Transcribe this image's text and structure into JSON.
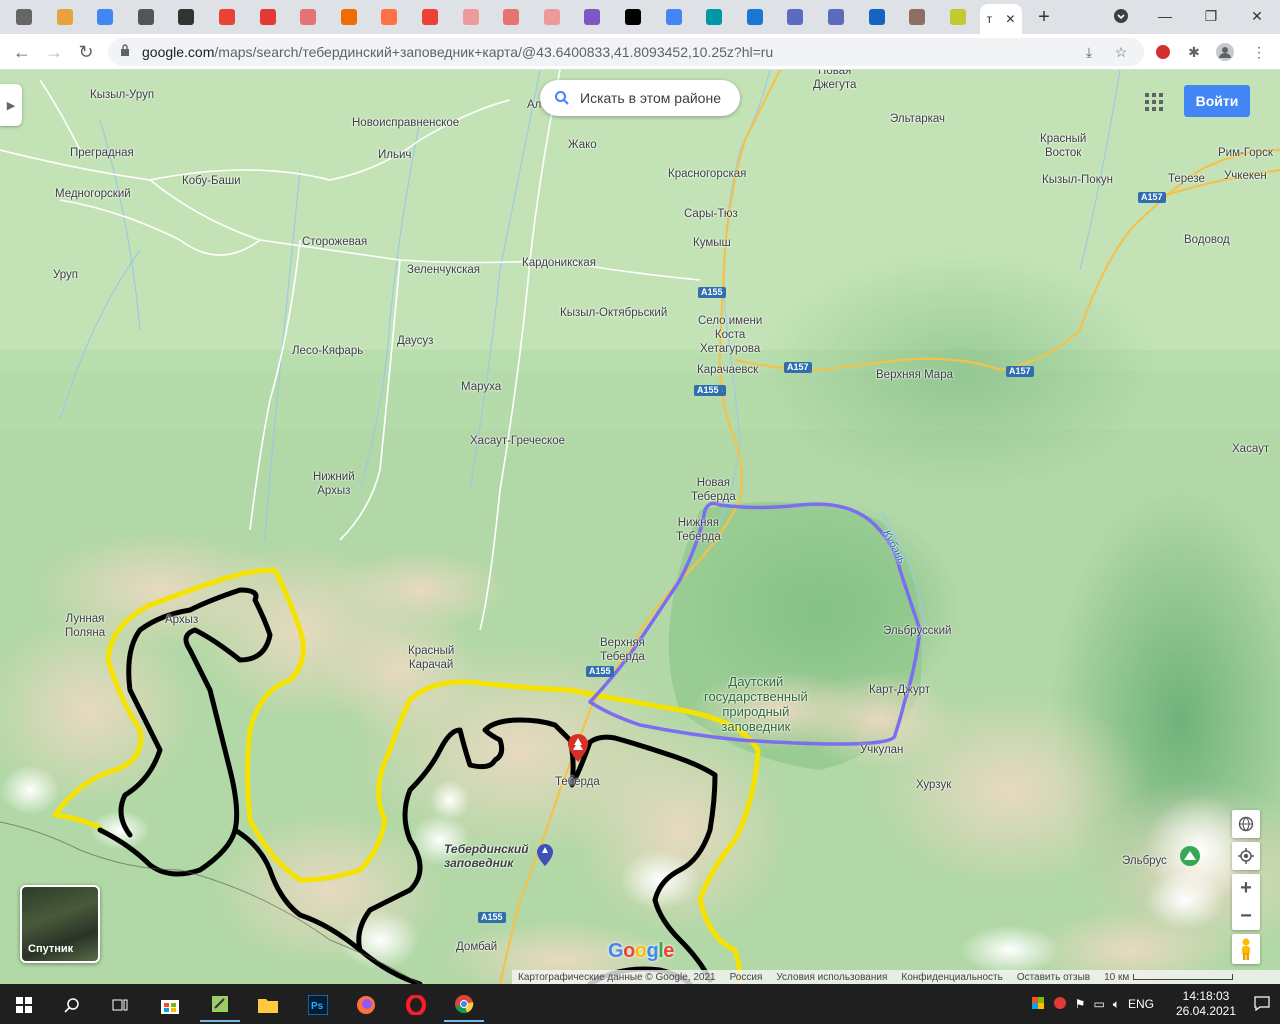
{
  "browser": {
    "active_tab_title": "т",
    "url_host": "google.com",
    "url_rest": "/maps/search/тебердинский+заповедник+карта/@43.6400833,41.8093452,10.25z?hl=ru",
    "tab_count": 24
  },
  "map": {
    "search_area_label": "Искать в этом районе",
    "signin_label": "Войти",
    "satellite_label": "Спутник",
    "google_logo": "Google",
    "attribution": {
      "data": "Картографические данные © Google, 2021",
      "country": "Россия",
      "terms": "Условия использования",
      "privacy": "Конфиденциальность",
      "feedback": "Оставить отзыв",
      "scale": "10 км"
    },
    "places": [
      {
        "id": "kyzyl-urup",
        "text": "Кызыл-Уруп"
      },
      {
        "id": "novoispravnenskoe",
        "text": "Новоисправненское"
      },
      {
        "id": "al",
        "text": "Ал"
      },
      {
        "id": "novaya-dzheguta",
        "text": "Новая\nДжегута"
      },
      {
        "id": "eltarkach",
        "text": "Эльтаркач"
      },
      {
        "id": "pregradnaya",
        "text": "Преградная"
      },
      {
        "id": "ilich",
        "text": "Ильич"
      },
      {
        "id": "zhako",
        "text": "Жако"
      },
      {
        "id": "krasny-vostok",
        "text": "Красный\nВосток"
      },
      {
        "id": "rim-gorsky",
        "text": "Рим-Горск"
      },
      {
        "id": "kobu-bashi",
        "text": "Кобу-Баши"
      },
      {
        "id": "krasnogorskaya",
        "text": "Красногорская"
      },
      {
        "id": "kyzyl-pokun",
        "text": "Кызыл-Покун"
      },
      {
        "id": "tereze",
        "text": "Терезе"
      },
      {
        "id": "uchkeken",
        "text": "Учкекен"
      },
      {
        "id": "mednogorsky",
        "text": "Медногорский"
      },
      {
        "id": "sary-tyuz",
        "text": "Сары-Тюз"
      },
      {
        "id": "storozhevaya",
        "text": "Сторожевая"
      },
      {
        "id": "kumysh",
        "text": "Кумыш"
      },
      {
        "id": "vodovod",
        "text": "Водовод"
      },
      {
        "id": "kardonikskaya",
        "text": "Кардоникская"
      },
      {
        "id": "zelenchukskaya",
        "text": "Зеленчукская"
      },
      {
        "id": "urup",
        "text": "Уруп"
      },
      {
        "id": "kyzyl-oktyabrsky",
        "text": "Кызыл-Октябрьский"
      },
      {
        "id": "selo-kosta",
        "text": "Село имени\nКоста\nХетагурова"
      },
      {
        "id": "dausuz",
        "text": "Даусуз"
      },
      {
        "id": "leso-kyafar",
        "text": "Лесо-Кяфарь"
      },
      {
        "id": "karachaevsk",
        "text": "Карачаевск"
      },
      {
        "id": "verkhnyaya-mara",
        "text": "Верхняя Мара"
      },
      {
        "id": "marukha",
        "text": "Маруха"
      },
      {
        "id": "khasaut-grecheskoe",
        "text": "Хасаут-Греческое"
      },
      {
        "id": "khasaut",
        "text": "Хасаут"
      },
      {
        "id": "nizhny-arkhyz",
        "text": "Нижний\nАрхыз"
      },
      {
        "id": "novaya-teberda",
        "text": "Новая\nТеберда"
      },
      {
        "id": "nizhnyaya-teberda",
        "text": "Нижняя\nТеберда"
      },
      {
        "id": "lunnaya-polyana",
        "text": "Лунная\nПоляна"
      },
      {
        "id": "arkhyz",
        "text": "Архыз"
      },
      {
        "id": "elbrussky",
        "text": "Эльбрусский"
      },
      {
        "id": "verkhnyaya-teberda",
        "text": "Верхняя\nТеберда"
      },
      {
        "id": "krasny-karachay",
        "text": "Красный\nКарачай"
      },
      {
        "id": "kart-dzhurt",
        "text": "Карт-Джурт"
      },
      {
        "id": "uchkulan",
        "text": "Учкулан"
      },
      {
        "id": "teberda",
        "text": "Теберда"
      },
      {
        "id": "khurzuk",
        "text": "Хурзук"
      },
      {
        "id": "elbrus",
        "text": "Эльбрус"
      },
      {
        "id": "dombay",
        "text": "Домбай"
      }
    ],
    "park_label": "Даутский\nгосударственный\nприродный\nзаповедник",
    "reserve_label": "Тебердинский\nзаповедник",
    "river_label": "Кубань",
    "road_shields": [
      "A157",
      "A155",
      "A155",
      "A157",
      "A157",
      "A155",
      "A155",
      "A155"
    ]
  },
  "taskbar": {
    "language": "ENG",
    "time": "14:18:03",
    "date": "26.04.2021"
  }
}
